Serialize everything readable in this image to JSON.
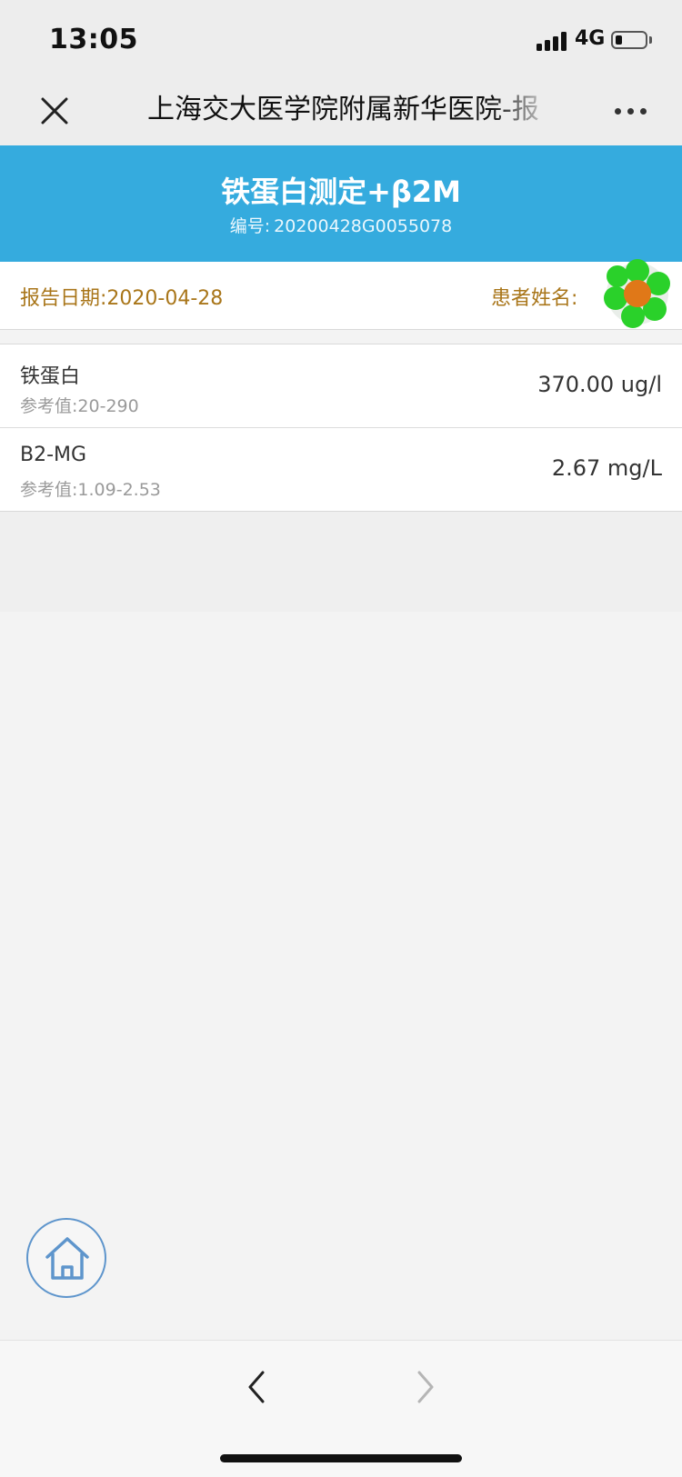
{
  "status_bar": {
    "time": "13:05",
    "network": "4G"
  },
  "nav": {
    "title": "上海交大医学院附属新华医院-报",
    "close_icon": "close-icon",
    "more_icon": "more-icon"
  },
  "report": {
    "title": "铁蛋白测定+β2M",
    "number_label": "编号:",
    "number_value": "20200428G0055078",
    "header_color": "#35abde"
  },
  "info": {
    "date_label": "报告日期:",
    "date_value": "2020-04-28",
    "patient_label": "患者姓名:",
    "label_color": "#a9761a"
  },
  "results": [
    {
      "name": "铁蛋白",
      "ref_label": "参考值:",
      "ref_value": "20-290",
      "value": "370.00 ug/l"
    },
    {
      "name": "B2-MG",
      "ref_label": "参考值:",
      "ref_value": "1.09-2.53",
      "value": "2.67 mg/L"
    }
  ],
  "toolbar": {
    "home_icon": "home-icon",
    "back_icon": "chevron-left-icon",
    "forward_icon": "chevron-right-icon"
  }
}
